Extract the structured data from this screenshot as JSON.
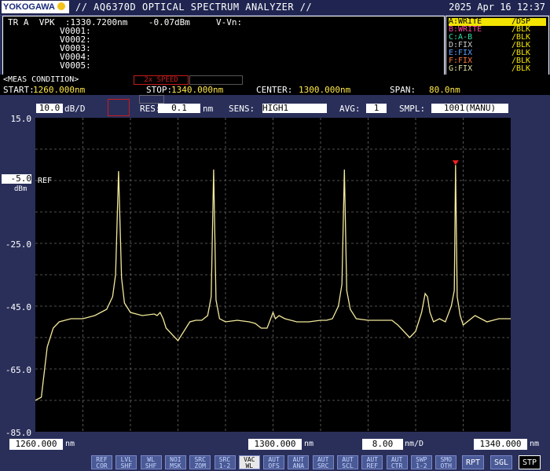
{
  "header": {
    "brand": "YOKOGAWA",
    "title": "// AQ6370D OPTICAL SPECTRUM ANALYZER //",
    "datetime": "2025 Apr 16 12:37"
  },
  "info": {
    "line1_label": "TR A  VPK  :",
    "line1_wl": "1330.7200nm",
    "line1_lvl": "-0.07dBm",
    "line1_delta": "V-Vn:",
    "markers": [
      "V0001:",
      "V0002:",
      "V0003:",
      "V0004:",
      "V0005:"
    ]
  },
  "traces": [
    {
      "label": "A:WRITE",
      "mode": "/DSP",
      "color": "#f2e400",
      "highlight": true
    },
    {
      "label": "B:WRITE",
      "mode": "/BLK",
      "color": "#ff4aa0",
      "highlight": false
    },
    {
      "label": "C:A-B",
      "mode": "/BLK",
      "color": "#33e0a0",
      "highlight": false
    },
    {
      "label": "D:FIX",
      "mode": "/BLK",
      "color": "#d0d0d0",
      "highlight": false
    },
    {
      "label": "E:FIX",
      "mode": "/BLK",
      "color": "#5aa0ff",
      "highlight": false
    },
    {
      "label": "F:FIX",
      "mode": "/BLK",
      "color": "#ff7a3a",
      "highlight": false
    },
    {
      "label": "G:FIX",
      "mode": "/BLK",
      "color": "#e0e0a0",
      "highlight": false
    }
  ],
  "meas": {
    "header": "<MEAS CONDITION>",
    "sweep_btn": "2x SPEED",
    "start_label": "START:",
    "start": "1260.000nm",
    "stop_label": "STOP:",
    "stop": "1340.000nm",
    "center_label": "CENTER:",
    "center": "1300.000nm",
    "span_label": "SPAN:",
    "span": "80.0nm"
  },
  "params": {
    "scale": "10.0",
    "scale_unit": "dB/D",
    "res_label": "RES:",
    "res": "0.1",
    "res_unit": "nm",
    "sens_label": "SENS:",
    "sens": "HIGH1",
    "avg_label": "AVG:",
    "avg": "1",
    "smpl_label": "SMPL:",
    "smpl": "1001(MANU)"
  },
  "yaxis": {
    "ticks": [
      "15.0",
      "-5.0",
      "-25.0",
      "-45.0",
      "-65.0",
      "-85.0"
    ],
    "ref_label": "REF",
    "ref_unit": "dBm"
  },
  "xaxis": {
    "start": "1260.000",
    "center": "1300.000",
    "stop": "1340.000",
    "unit": "nm",
    "div": "8.00",
    "div_unit": "nm/D"
  },
  "softkeys": [
    [
      "REF",
      "COR"
    ],
    [
      "LVL",
      "SHF"
    ],
    [
      "WL",
      "SHF"
    ],
    [
      "NOI",
      "MSK"
    ],
    [
      "SRC",
      "ZOM"
    ],
    [
      "SRC",
      "1-2"
    ],
    [
      "VAC",
      "WL"
    ],
    [
      "AUT",
      "OFS"
    ],
    [
      "AUT",
      "ANA"
    ],
    [
      "AUT",
      "SRC"
    ],
    [
      "AUT",
      "SCL"
    ],
    [
      "AUT",
      "REF"
    ],
    [
      "AUT",
      "CTR"
    ],
    [
      "SWP",
      "1-2"
    ],
    [
      "SMO",
      "OTH"
    ]
  ],
  "buttons": {
    "rpt": "RPT",
    "sgl": "SGL",
    "stp": "STP"
  },
  "colors": {
    "trace": "#f2e89a",
    "grid": "#6a6a6a",
    "marker": "#ff2020",
    "accent": "#f2e400"
  },
  "chart_data": {
    "type": "line",
    "xlim": [
      1260,
      1340
    ],
    "ylim": [
      -85,
      15
    ],
    "xlabel": "",
    "ylabel": "",
    "ref_level": -5.0,
    "x": [
      1260,
      1261,
      1262,
      1263,
      1264,
      1265,
      1266,
      1268,
      1270,
      1271,
      1272,
      1273,
      1273.5,
      1274,
      1274.5,
      1275,
      1276,
      1278,
      1280,
      1280.5,
      1281,
      1281.5,
      1282,
      1284,
      1286,
      1287,
      1288,
      1289,
      1289.6,
      1290,
      1290.4,
      1291,
      1292,
      1294,
      1296,
      1297,
      1298,
      1299,
      1299.6,
      1300,
      1300.4,
      1301,
      1302,
      1304,
      1306,
      1308,
      1309,
      1310,
      1311,
      1311.6,
      1312,
      1312.4,
      1313,
      1314,
      1316,
      1318,
      1320,
      1321,
      1322,
      1323,
      1324,
      1325,
      1325.6,
      1326,
      1326.4,
      1327,
      1328,
      1329,
      1330,
      1330.5,
      1330.72,
      1331,
      1331.5,
      1332,
      1334,
      1336,
      1338,
      1340
    ],
    "y": [
      -75,
      -74,
      -58,
      -52,
      -50,
      -49.5,
      -49,
      -49,
      -48,
      -47,
      -46,
      -42,
      -35,
      -2,
      -36,
      -44,
      -47,
      -48,
      -47.5,
      -48,
      -47,
      -49,
      -52,
      -56,
      -50,
      -49.5,
      -49.5,
      -48,
      -42,
      -1.5,
      -43,
      -49,
      -50,
      -49.5,
      -50,
      -50.5,
      -52,
      -52,
      -49,
      -47,
      -49,
      -48,
      -49,
      -50,
      -50,
      -49.5,
      -49.5,
      -49,
      -45,
      -38,
      -1.5,
      -40,
      -46,
      -49,
      -49.5,
      -49.5,
      -49.5,
      -51,
      -53,
      -55,
      -53,
      -47,
      -41,
      -42,
      -47,
      -50,
      -49,
      -50,
      -45,
      -40,
      -0.07,
      -42,
      -48,
      -51,
      -48,
      -50,
      -49,
      -49
    ]
  }
}
